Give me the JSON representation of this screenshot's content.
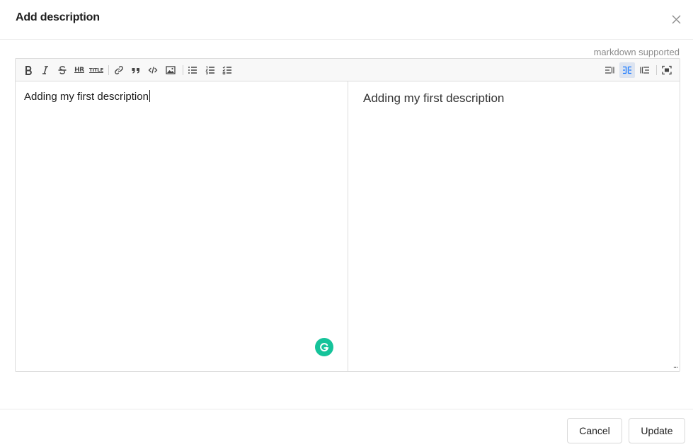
{
  "modal": {
    "title": "Add description",
    "close_icon": "close-icon"
  },
  "editor": {
    "note": "markdown supported",
    "toolbar": {
      "left_tools": [
        {
          "icon": "bold-icon"
        },
        {
          "icon": "italic-icon"
        },
        {
          "icon": "strikethrough-icon"
        },
        {
          "icon": "horizontal-rule-icon",
          "label": "HR"
        },
        {
          "icon": "title-icon",
          "label": "TITLE"
        },
        {
          "icon": "link-icon"
        },
        {
          "icon": "quote-icon"
        },
        {
          "icon": "code-icon"
        },
        {
          "icon": "image-icon"
        },
        {
          "icon": "unordered-list-icon"
        },
        {
          "icon": "ordered-list-icon"
        },
        {
          "icon": "checklist-icon"
        }
      ],
      "right_tools": [
        {
          "icon": "edit-only-icon",
          "active": false
        },
        {
          "icon": "split-view-icon",
          "active": true
        },
        {
          "icon": "preview-only-icon",
          "active": false
        },
        {
          "icon": "fullscreen-icon",
          "active": false
        }
      ]
    },
    "content": "Adding my first description",
    "preview": "Adding my first description",
    "grammarly_icon": "grammarly-icon",
    "resize_handle": "..."
  },
  "footer": {
    "cancel_label": "Cancel",
    "update_label": "Update"
  },
  "colors": {
    "accent": "#1677ff",
    "grammarly": "#15c39a",
    "border": "#dcdcdc",
    "toolbar_bg": "#f8f8f8"
  }
}
